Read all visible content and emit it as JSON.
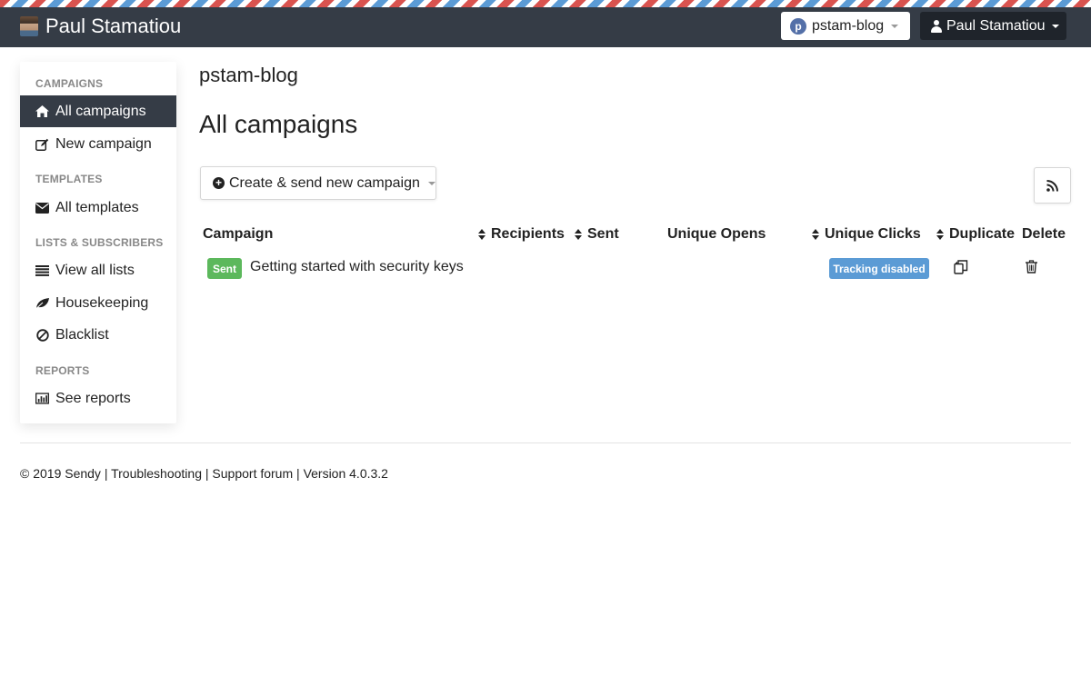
{
  "navbar": {
    "brand_name": "Paul Stamatiou",
    "brand_selector": "pstam-blog",
    "user_menu": "Paul Stamatiou"
  },
  "sidebar": {
    "sections": [
      {
        "heading": "CAMPAIGNS"
      },
      {
        "heading": "TEMPLATES"
      },
      {
        "heading": "LISTS & SUBSCRIBERS"
      },
      {
        "heading": "REPORTS"
      }
    ],
    "items": [
      {
        "label": "All campaigns",
        "icon": "home-icon",
        "active": true
      },
      {
        "label": "New campaign",
        "icon": "edit-icon"
      },
      {
        "label": "All templates",
        "icon": "envelope-icon"
      },
      {
        "label": "View all lists",
        "icon": "list-icon"
      },
      {
        "label": "Housekeeping",
        "icon": "leaf-icon"
      },
      {
        "label": "Blacklist",
        "icon": "ban-icon"
      },
      {
        "label": "See reports",
        "icon": "bar-chart-icon"
      }
    ]
  },
  "main": {
    "brand_title": "pstam-blog",
    "page_title": "All campaigns",
    "create_button": "Create & send new campaign",
    "table": {
      "headers": [
        "Campaign",
        "Recipients",
        "Sent",
        "Unique Opens",
        "Unique Clicks",
        "Duplicate",
        "Delete"
      ],
      "rows": [
        {
          "status": "Sent",
          "name": "Getting started with security keys",
          "tracking": "Tracking disabled"
        }
      ]
    }
  },
  "footer": {
    "copyright": "© 2019 Sendy",
    "links": [
      "Troubleshooting",
      "Support forum"
    ],
    "version": "Version 4.0.3.2",
    "separator": " | "
  },
  "colors": {
    "navbar": "#353c46",
    "sent_badge": "#5cb85c",
    "tracking_badge": "#5b9bd5"
  }
}
